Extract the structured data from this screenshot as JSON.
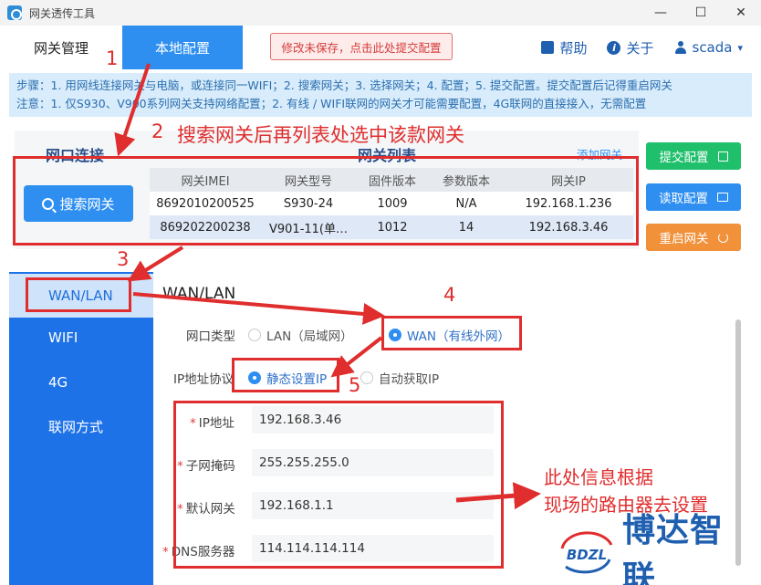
{
  "window": {
    "title": "网关透传工具",
    "minimize": "—",
    "maximize": "☐",
    "close": "✕"
  },
  "menu": {
    "tab_gateway": "网关管理",
    "tab_local": "本地配置",
    "unsaved": "修改未保存，点击此处提交配置",
    "help": "帮助",
    "about": "关于",
    "user": "scada",
    "caret": "▾",
    "info_icon_glyph": "i"
  },
  "banner": {
    "steps": "步骤：1. 用网线连接网关与电脑，或连接同一WIFI；2. 搜索网关；3. 选择网关；4. 配置；5. 提交配置。提交配置后记得重启网关",
    "notes": "注意：1. 仅S930、V900系列网关支持网络配置；2. 有线 / WIFI联网的网关才可能需要配置，4G联网的直接接入，无需配置"
  },
  "panel": {
    "port_title": "网口连接",
    "list_title": "网关列表",
    "add_link": "添加网关",
    "search_button": "搜索网关",
    "columns": [
      "网关IMEI",
      "网关型号",
      "固件版本",
      "参数版本",
      "网关IP"
    ],
    "rows": [
      [
        "8692010200525",
        "S930-24",
        "1009",
        "N/A",
        "192.168.1.236"
      ],
      [
        "869202200238",
        "V901-11(单…",
        "1012",
        "14",
        "192.168.3.46"
      ]
    ]
  },
  "actions": {
    "submit": "提交配置",
    "read": "读取配置",
    "restart": "重启网关"
  },
  "sidebar": {
    "items": [
      "WAN/LAN",
      "WIFI",
      "4G",
      "联网方式"
    ]
  },
  "form": {
    "title": "WAN/LAN",
    "port_type_label": "网口类型",
    "lan_option": "LAN（局域网）",
    "wan_option": "WAN（有线外网）",
    "ip_protocol_label": "IP地址协议",
    "static_option": "静态设置IP",
    "dhcp_option": "自动获取IP",
    "required_mark": "*",
    "ip_label": "IP地址",
    "ip_value": "192.168.3.46",
    "mask_label": "子网掩码",
    "mask_value": "255.255.255.0",
    "gateway_label": "默认网关",
    "gateway_value": "192.168.1.1",
    "dns_label": "DNS服务器",
    "dns_value": "114.114.114.114"
  },
  "annotations": {
    "n1": "1",
    "n2": "2",
    "n3": "3",
    "n4": "4",
    "n5": "5",
    "step2_text": "搜索网关后再列表处选中该款网关",
    "note_line1": "此处信息根据",
    "note_line2": "现场的路由器去设置"
  },
  "logo": {
    "mark": "BDZL",
    "name": "博达智联"
  },
  "colors": {
    "primary": "#2e8ff0",
    "sidebar": "#1e72e8",
    "annotation_red": "#e02d2d",
    "submit_green": "#1fbf6b",
    "restart_orange": "#f1913a",
    "logo_blue": "#1f5fb0",
    "logo_red": "#e02d2d"
  }
}
